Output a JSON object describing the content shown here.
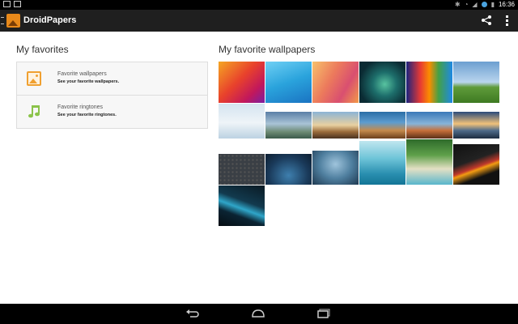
{
  "status_bar": {
    "time": "16:36"
  },
  "action_bar": {
    "title": "DroidPapers"
  },
  "left": {
    "heading": "My favorites",
    "items": [
      {
        "title": "Favorite wallpapers",
        "subtitle": "See your favorite wallpapers."
      },
      {
        "title": "Favorite ringtones",
        "subtitle": "See your favorite ringtones."
      }
    ]
  },
  "right": {
    "heading": "My favorite wallpapers"
  },
  "colors": {
    "accent": "#e8891a",
    "ringtone_icon": "#8bc34a",
    "action_bar": "#1f1f1f"
  },
  "icons": {
    "app": "app-logo-icon",
    "share": "share-icon",
    "overflow": "overflow-menu-icon",
    "back": "back-icon",
    "home": "home-icon",
    "recents": "recents-icon"
  }
}
